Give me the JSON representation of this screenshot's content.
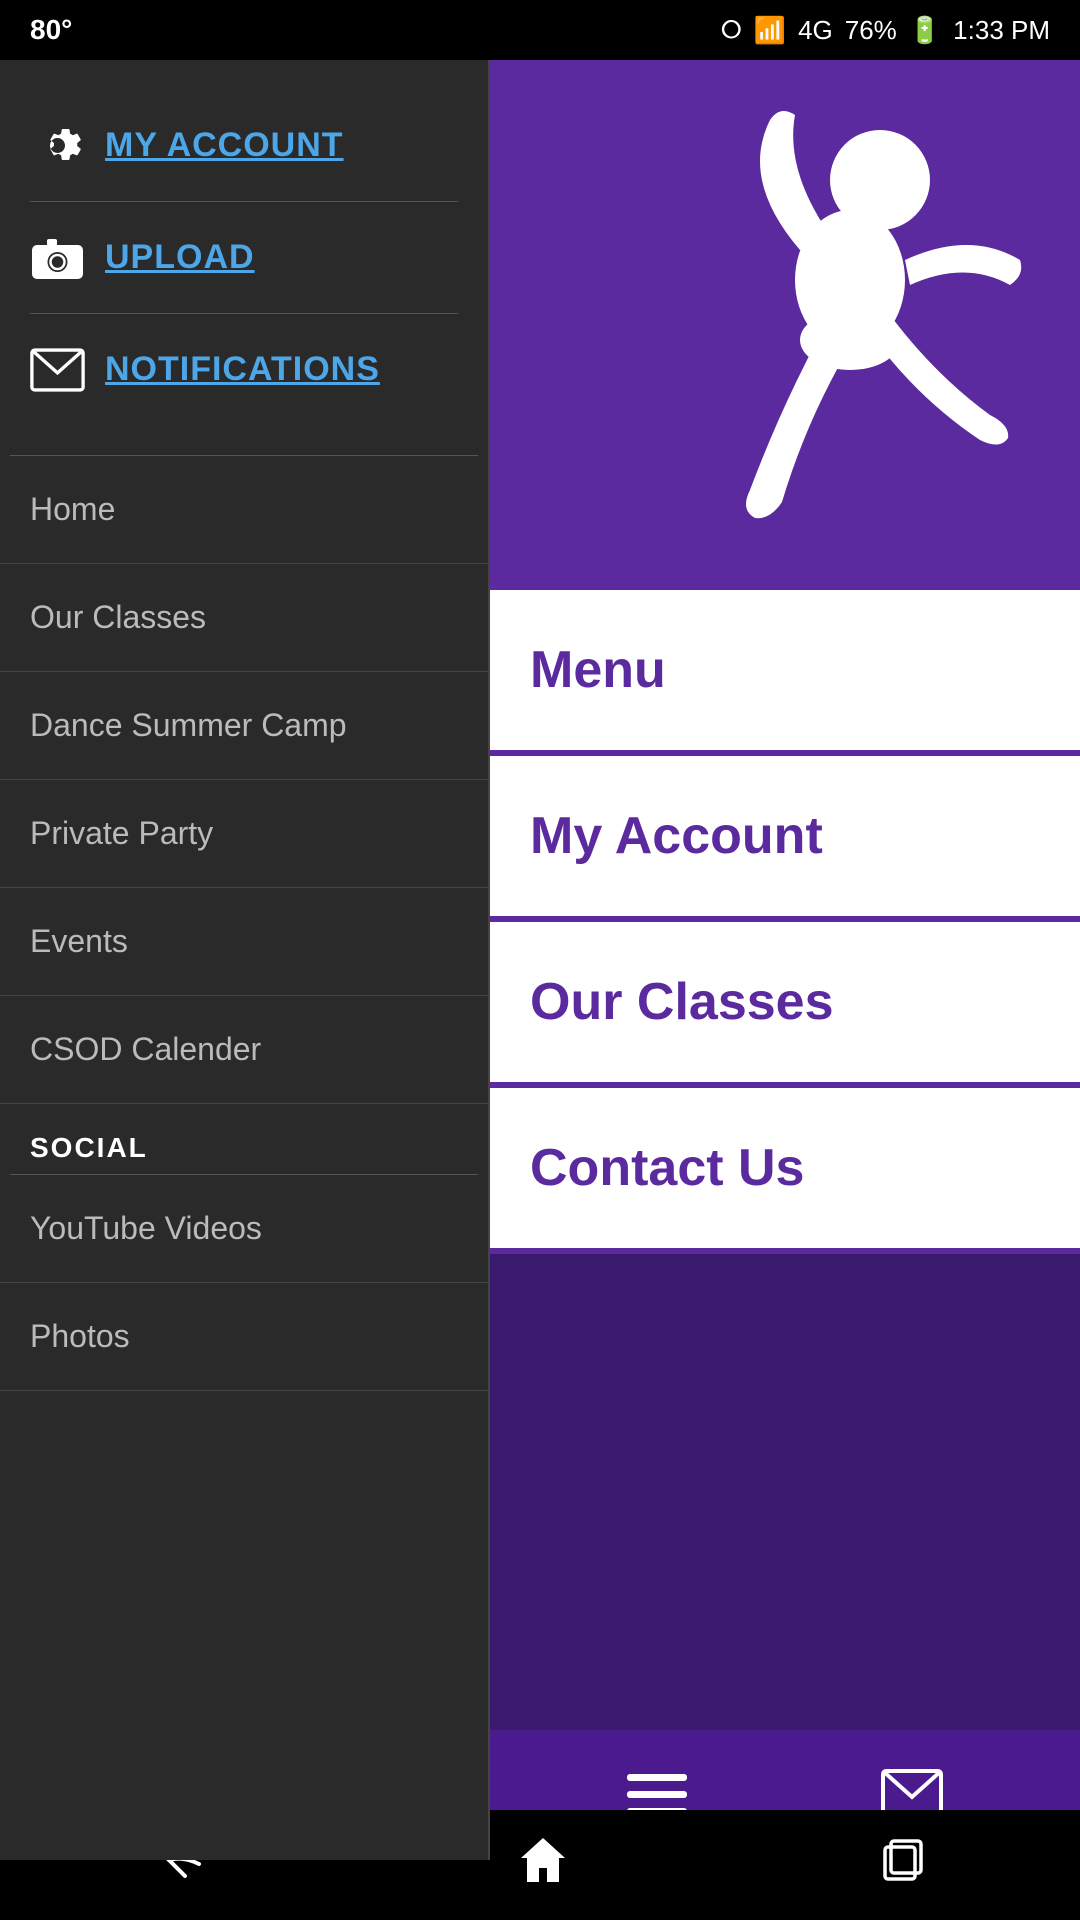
{
  "statusBar": {
    "temperature": "80°",
    "battery": "76%",
    "time": "1:33 PM"
  },
  "sidebar": {
    "actions": [
      {
        "id": "my-account",
        "label": "MY ACCOUNT",
        "icon": "gear"
      },
      {
        "id": "upload",
        "label": "UPLOAD",
        "icon": "camera"
      },
      {
        "id": "notifications",
        "label": "NOTIFICATIONS",
        "icon": "mail"
      }
    ],
    "navItems": [
      {
        "id": "home",
        "label": "Home"
      },
      {
        "id": "our-classes",
        "label": "Our Classes"
      },
      {
        "id": "dance-summer-camp",
        "label": "Dance Summer Camp"
      },
      {
        "id": "private-party",
        "label": "Private Party"
      },
      {
        "id": "events",
        "label": "Events"
      },
      {
        "id": "csod-calender",
        "label": "CSOD Calender"
      }
    ],
    "socialSection": {
      "label": "SOCIAL",
      "items": [
        {
          "id": "youtube-videos",
          "label": "YouTube Videos"
        },
        {
          "id": "photos",
          "label": "Photos"
        }
      ]
    }
  },
  "content": {
    "menuCards": [
      {
        "id": "menu",
        "label": "Menu"
      },
      {
        "id": "my-account",
        "label": "My Account"
      },
      {
        "id": "our-classes",
        "label": "Our Classes"
      },
      {
        "id": "contact-us",
        "label": "Contact Us"
      }
    ]
  },
  "bottomBar": {
    "icons": [
      "hamburger",
      "mail"
    ]
  },
  "navBar": {
    "back": "←",
    "home": "⌂",
    "recents": "▣"
  }
}
